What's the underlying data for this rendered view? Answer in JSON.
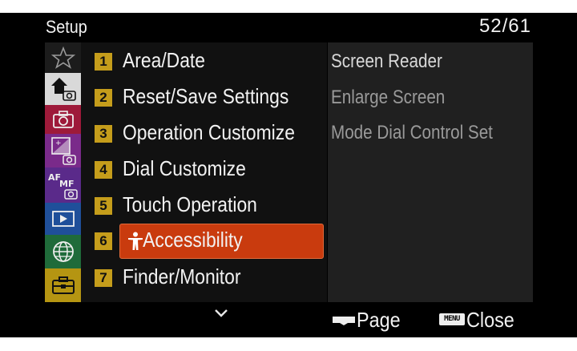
{
  "header": {
    "title": "Setup",
    "page": "52/61"
  },
  "sidebar": {
    "tabs": [
      {
        "icon": "star-icon",
        "color": "#3a3a3a"
      },
      {
        "icon": "home-camera-icon",
        "color": "#3a3a3a"
      },
      {
        "icon": "camera-icon",
        "color": "#9e1a3a"
      },
      {
        "icon": "exposure-camera-icon",
        "color": "#7a2a8a"
      },
      {
        "icon": "af-mf-icon",
        "color": "#5a2a8a"
      },
      {
        "icon": "playback-icon",
        "color": "#1f4f9a"
      },
      {
        "icon": "globe-icon",
        "color": "#1f6b3a"
      },
      {
        "icon": "toolbox-icon",
        "color": "#b59512"
      }
    ]
  },
  "menu": {
    "items": [
      {
        "num": "1",
        "label": "Area/Date"
      },
      {
        "num": "2",
        "label": "Reset/Save Settings"
      },
      {
        "num": "3",
        "label": "Operation Customize"
      },
      {
        "num": "4",
        "label": "Dial Customize"
      },
      {
        "num": "5",
        "label": "Touch Operation"
      },
      {
        "num": "6",
        "label": "Accessibility",
        "selected": true
      },
      {
        "num": "7",
        "label": "Finder/Monitor"
      }
    ]
  },
  "submenu": {
    "items": [
      {
        "label": "Screen Reader"
      },
      {
        "label": "Enlarge Screen"
      },
      {
        "label": "Mode Dial Control Set"
      }
    ]
  },
  "footer": {
    "page_label": "Page",
    "menu_key": "MENU",
    "close_label": "Close"
  },
  "colors": {
    "accent": "#c93b0e",
    "number_badge": "#c59d1b"
  }
}
